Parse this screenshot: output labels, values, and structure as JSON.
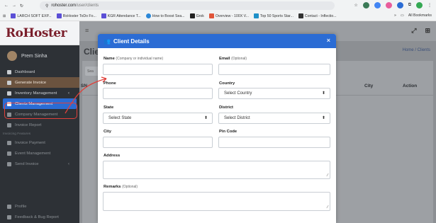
{
  "browser": {
    "url_host": "rohoster.com",
    "url_path": "/user/clients",
    "bookmarks": [
      {
        "label": "LARCH SOFT EXP...",
        "color": "#5b4fd6"
      },
      {
        "label": "RoHoster ToDo Fo...",
        "color": "#5b4fd6"
      },
      {
        "label": "KGR Attendance T...",
        "color": "#5b4fd6"
      },
      {
        "label": "How to Boost Sea...",
        "color": "#2b88d8"
      },
      {
        "label": "Grok",
        "color": "#222222"
      },
      {
        "label": "Overview - 100X V...",
        "color": "#e0553a"
      },
      {
        "label": "Top 50 Sports Star...",
        "color": "#1e90c8"
      },
      {
        "label": "Contact - Inflectio...",
        "color": "#333333"
      }
    ],
    "all_bookmarks": "All Bookmarks"
  },
  "sidebar": {
    "logo": "RoHoster",
    "user_name": "Prem Sinha",
    "items": [
      {
        "label": "Dashboard",
        "icon": "gauge-icon"
      },
      {
        "label": "Generate Invoice",
        "icon": "file-icon"
      },
      {
        "label": "Inventory Management",
        "icon": "boxes-icon",
        "caret": "‹"
      },
      {
        "label": "Clients Management",
        "icon": "users-icon"
      },
      {
        "label": "Company Management",
        "icon": "building-icon"
      },
      {
        "label": "Invoice Report",
        "icon": "report-icon"
      },
      {
        "label": "Invoice Payment",
        "icon": "card-icon"
      },
      {
        "label": "Event Management",
        "icon": "calendar-icon"
      },
      {
        "label": "Send Invoice",
        "icon": "send-icon",
        "caret": "‹"
      },
      {
        "label": "Profile",
        "icon": "person-icon"
      },
      {
        "label": "Feedback & Bug Report",
        "icon": "bug-icon"
      }
    ],
    "section_label": "Invoicing Features"
  },
  "main": {
    "page_title": "Clier",
    "breadcrumb": "Home / Clients",
    "search_stub": "Sea",
    "table_headers": {
      "sn": "SN",
      "city": "City",
      "action": "Action"
    }
  },
  "modal": {
    "title": "Client Details",
    "close": "×",
    "fields": {
      "name_label": "Name",
      "name_hint": "(Company or individual name)",
      "email_label": "Email",
      "email_hint": "(Optional)",
      "phone_label": "Phone",
      "country_label": "Country",
      "country_value": "Select Country",
      "state_label": "State",
      "state_value": "Select State",
      "district_label": "District",
      "district_value": "Select District",
      "city_label": "City",
      "pincode_label": "Pin Code",
      "address_label": "Address",
      "remarks_label": "Remarks",
      "remarks_hint": "(Optional)"
    }
  },
  "colors": {
    "accent": "#2b6cd4",
    "annotation": "#e0403a",
    "brand": "#7a1e2b"
  }
}
